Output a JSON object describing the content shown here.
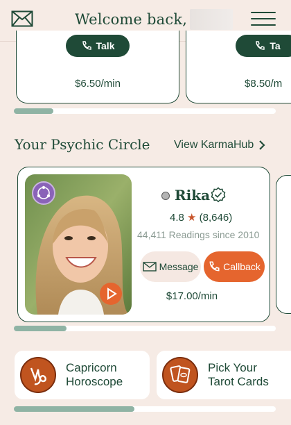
{
  "header": {
    "welcome": "Welcome back, J",
    "icons": {
      "mail": "mail-icon",
      "menu": "hamburger-menu-icon"
    }
  },
  "top_carousel": {
    "cards": [
      {
        "button": "Talk",
        "price": "$6.50/min"
      },
      {
        "button": "Ta",
        "price": "$8.50/m"
      }
    ],
    "scroll_fraction": 0.15
  },
  "circle": {
    "title": "Your Psychic Circle",
    "view_link": "View KarmaHub",
    "psychic": {
      "name": "Rika",
      "status_color": "#b4b4b4",
      "rating": "4.8",
      "reviews": "(8,646)",
      "readings": "44,411 Readings since 2010",
      "message_label": "Message",
      "callback_label": "Callback",
      "price": "$17.00/min"
    },
    "scroll_fraction": 0.2
  },
  "tiles": [
    {
      "label_line1": "Capricorn",
      "label_line2": "Horoscope",
      "icon": "capricorn-icon"
    },
    {
      "label_line1": "Pick Your",
      "label_line2": "Tarot Cards",
      "icon": "tarot-cards-icon"
    }
  ],
  "tiles_scroll_fraction": 0.46,
  "colors": {
    "brand_green": "#1f4a37",
    "accent_orange": "#e5652e",
    "background": "#f6ebe5"
  }
}
